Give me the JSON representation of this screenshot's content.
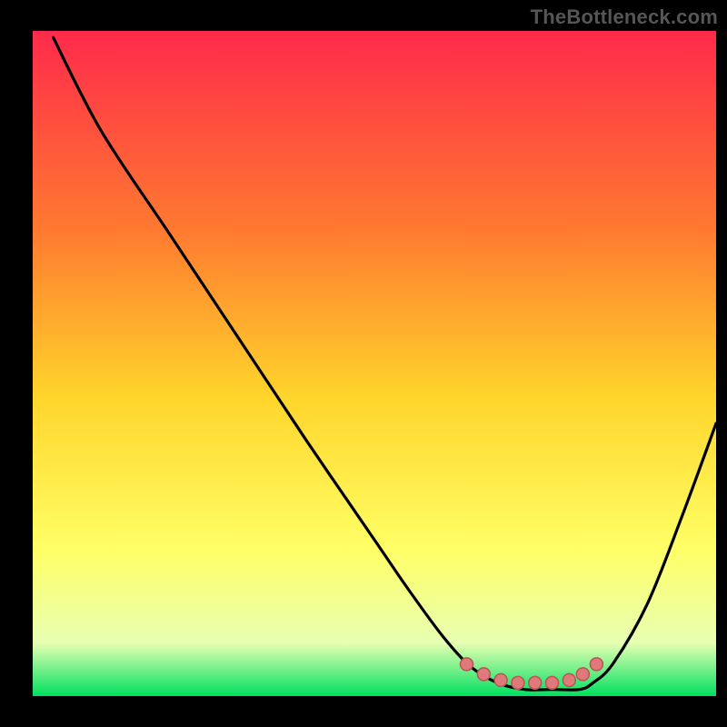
{
  "watermark": "TheBottleneck.com",
  "colors": {
    "frame": "#000000",
    "gradient_top": "#ff2a4b",
    "gradient_mid1": "#ff7a30",
    "gradient_mid2": "#ffd52b",
    "gradient_mid3": "#ffff66",
    "gradient_mid4": "#e8ffb3",
    "gradient_bottom": "#00e060",
    "curve": "#000000",
    "points_fill": "#e07a7a",
    "points_stroke": "#b85555"
  },
  "chart_data": {
    "type": "line",
    "title": "",
    "xlabel": "",
    "ylabel": "",
    "xlim": [
      0,
      100
    ],
    "ylim": [
      0,
      100
    ],
    "curve": {
      "x": [
        3,
        10,
        20,
        30,
        40,
        50,
        55,
        60,
        64,
        68,
        72,
        76,
        80,
        82,
        85,
        90,
        95,
        100
      ],
      "y": [
        99,
        85,
        69.5,
        54,
        38.5,
        23.5,
        16,
        9,
        4.5,
        2,
        1,
        1,
        1,
        2,
        5,
        14,
        27,
        41
      ]
    },
    "series": [
      {
        "name": "optimum-points",
        "x": [
          63.5,
          66,
          68.5,
          71,
          73.5,
          76,
          78.5,
          80.5,
          82.5
        ],
        "y": [
          4.8,
          3.3,
          2.4,
          2.0,
          2.0,
          2.0,
          2.4,
          3.3,
          4.8
        ]
      }
    ]
  }
}
